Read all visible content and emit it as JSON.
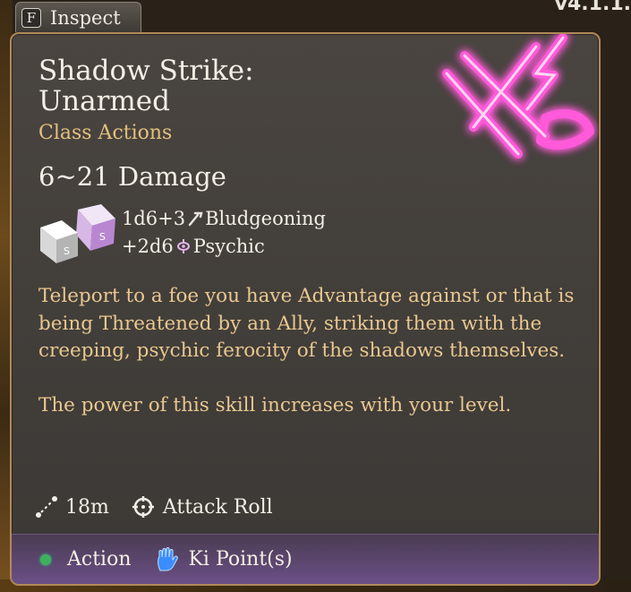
{
  "version": "v4.1.1.",
  "inspect": {
    "key": "F",
    "label": "Inspect"
  },
  "spell": {
    "title_line1": "Shadow Strike:",
    "title_line2": "Unarmed",
    "category": "Class Actions",
    "damage_total": "6~21 Damage",
    "damage_lines": [
      {
        "dice": "1d6+3",
        "type": "Bludgeoning",
        "icon": "bludgeon-icon"
      },
      {
        "dice": "+2d6",
        "type": "Psychic",
        "icon": "psychic-icon"
      }
    ],
    "description": [
      "Teleport to a foe you have Advantage against or that is being Threatened by an Ally, striking them with the creeping, psychic ferocity of the shadows themselves.",
      "The power of this skill increases with your level."
    ],
    "range": "18m",
    "roll_type": "Attack Roll",
    "cost": [
      {
        "label": "Action",
        "icon": "action-dot-icon",
        "color": "#3fb05c"
      },
      {
        "label": "Ki Point(s)",
        "icon": "ki-hand-icon",
        "color": "#3a8cff"
      }
    ]
  },
  "colors": {
    "panel_border": "#b08a5a",
    "category_text": "#e3c07e",
    "description_text": "#e8c890",
    "emblem_glow": "#ff4fd8"
  }
}
